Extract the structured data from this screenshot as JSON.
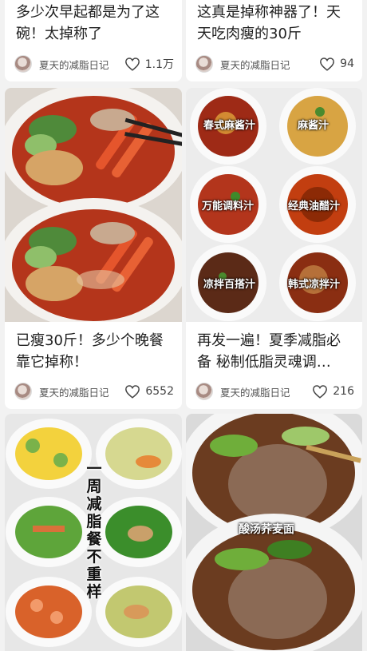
{
  "cards": [
    {
      "title": "多少次早起都是为了这碗！太掉称了",
      "author": "夏天的减脂日记",
      "likes": "1.1万"
    },
    {
      "title": "这真是掉称神器了！天天吃肉瘦的30斤",
      "author": "夏天的减脂日记",
      "likes": "94"
    },
    {
      "title": "已瘦30斤！多少个晚餐靠它掉称！",
      "author": "夏天的减脂日记",
      "likes": "6552"
    },
    {
      "title": "再发一遍！夏季减脂必备 秘制低脂灵魂调…",
      "author": "夏天的减脂日记",
      "likes": "216"
    }
  ],
  "sauce_labels": [
    "春式麻酱汁",
    "麻酱汁",
    "万能调料汁",
    "经典油醋汁",
    "凉拌百搭汁",
    "韩式凉拌汁"
  ],
  "meal_plan_label": "一周减脂餐不重样",
  "noodle_label": "酸汤荞麦面",
  "icons": {
    "like": "heart-outline-icon",
    "avatar": "avatar"
  }
}
